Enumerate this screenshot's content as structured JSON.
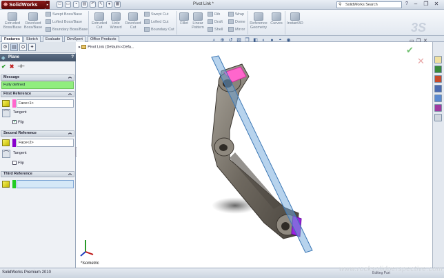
{
  "app": {
    "logo": "SolidWorks",
    "doc_title": "Pivot Link *",
    "search_placeholder": "SolidWorks Search"
  },
  "ribbon": {
    "extruded_boss": "Extruded Boss/Base",
    "revolved_boss": "Revolved Boss/Base",
    "swept_boss": "Swept Boss/Base",
    "lofted_boss": "Lofted Boss/Base",
    "boundary_boss": "Boundary Boss/Base",
    "extruded_cut": "Extruded Cut",
    "hole_wizard": "Hole Wizard",
    "revolved_cut": "Revolved Cut",
    "swept_cut": "Swept Cut",
    "lofted_cut": "Lofted Cut",
    "boundary_cut": "Boundary Cut",
    "fillet": "Fillet",
    "linear_pattern": "Linear Pattern",
    "rib": "Rib",
    "draft": "Draft",
    "shell": "Shell",
    "wrap": "Wrap",
    "dome": "Dome",
    "mirror": "Mirror",
    "reference_geometry": "Reference Geometry",
    "curves": "Curves",
    "instant3d": "Instant3D"
  },
  "tabs": [
    {
      "label": "Features",
      "active": true
    },
    {
      "label": "Sketch"
    },
    {
      "label": "Evaluate"
    },
    {
      "label": "DimXpert"
    },
    {
      "label": "Office Products"
    }
  ],
  "property_manager": {
    "title": "Plane",
    "help": "?",
    "message_header": "Message",
    "message": "Fully defined",
    "first_reference": {
      "header": "First Reference",
      "value": "Face<1>",
      "swatch": "#ff66cc",
      "tangent": "Tangent",
      "flip": "Flip",
      "flip_checked": true
    },
    "second_reference": {
      "header": "Second Reference",
      "value": "Face<2>",
      "swatch": "#8800cc",
      "tangent": "Tangent",
      "flip": "Flip",
      "flip_checked": false
    },
    "third_reference": {
      "header": "Third Reference",
      "value": "",
      "swatch": "#22cc22"
    }
  },
  "tree": {
    "root": "Pivot Link  (Default<<Defa..."
  },
  "view": {
    "name": "*Isometric"
  },
  "status": {
    "left": "SolidWorks Premium 2010",
    "right": "Editing Part"
  },
  "watermark": "www.rocksolidperspective.com",
  "colors": {
    "face1": "#ff66cc",
    "face2": "#8800cc",
    "plane": "#6fa8dc",
    "message_bg": "#90ee7e"
  }
}
